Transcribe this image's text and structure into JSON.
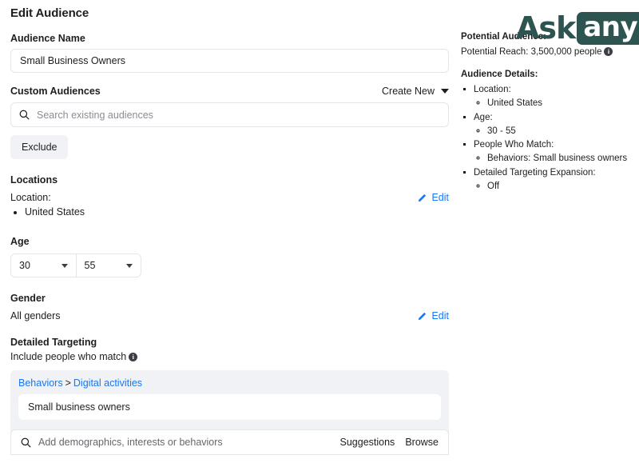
{
  "page_title": "Edit Audience",
  "logo": {
    "part1": "Ask",
    "part2": "any",
    "color": "#2d5450"
  },
  "audience_name": {
    "label": "Audience Name",
    "value": "Small Business Owners"
  },
  "custom_audiences": {
    "label": "Custom Audiences",
    "create_new_label": "Create New",
    "search_placeholder": "Search existing audiences",
    "exclude_label": "Exclude"
  },
  "locations": {
    "section_label": "Locations",
    "location_label": "Location:",
    "items": [
      "United States"
    ],
    "edit_label": "Edit"
  },
  "age": {
    "section_label": "Age",
    "min": "30",
    "max": "55"
  },
  "gender": {
    "section_label": "Gender",
    "value": "All genders",
    "edit_label": "Edit"
  },
  "detailed_targeting": {
    "section_label": "Detailed Targeting",
    "include_label": "Include people who match",
    "breadcrumb": {
      "parent": "Behaviors",
      "separator": ">",
      "child": "Digital activities"
    },
    "selected_item": "Small business owners",
    "search_placeholder": "Add demographics, interests or behaviors",
    "suggestions_label": "Suggestions",
    "browse_label": "Browse"
  },
  "right_panel": {
    "potential_audience_label": "Potential Audience:",
    "potential_reach": "Potential Reach: 3,500,000 people",
    "audience_details_label": "Audience Details:",
    "details": [
      {
        "label": "Location:",
        "value": "United States"
      },
      {
        "label": "Age:",
        "value": "30 - 55"
      },
      {
        "label": "People Who Match:",
        "value": "Behaviors: Small business owners"
      },
      {
        "label": "Detailed Targeting Expansion:",
        "value": "Off"
      }
    ]
  },
  "colors": {
    "link": "#1877f2",
    "panel_bg": "#f0f2f5",
    "border": "#e4e6eb"
  }
}
